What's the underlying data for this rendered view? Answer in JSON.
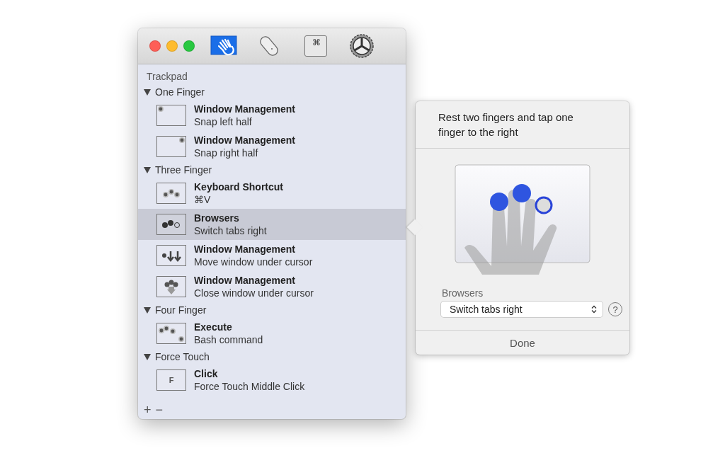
{
  "window": {
    "controls": [
      {
        "kind": "close"
      },
      {
        "kind": "minimize"
      },
      {
        "kind": "zoom"
      }
    ]
  },
  "toolbar": {
    "tabs": [
      {
        "kind": "trackpad",
        "selected": true
      },
      {
        "kind": "mouse",
        "selected": false
      },
      {
        "kind": "keyboard",
        "glyph": "⌘",
        "selected": false
      },
      {
        "kind": "settings",
        "selected": false
      }
    ]
  },
  "sidebar": {
    "title": "Trackpad",
    "sections": [
      {
        "label": "One Finger",
        "expanded": true,
        "items": [
          {
            "kind": "dot-left",
            "title": "Window Management",
            "subtitle": "Snap left half",
            "selected": false
          },
          {
            "kind": "dot-right",
            "title": "Window Management",
            "subtitle": "Snap right half",
            "selected": false
          }
        ]
      },
      {
        "label": "Three Finger",
        "expanded": true,
        "items": [
          {
            "kind": "three-dots",
            "title": "Keyboard Shortcut",
            "subtitle": "⌘V",
            "selected": false
          },
          {
            "kind": "tap-right",
            "title": "Browsers",
            "subtitle": "Switch tabs right",
            "selected": true
          },
          {
            "kind": "move-down",
            "title": "Window Management",
            "subtitle": "Move window under cursor",
            "selected": false
          },
          {
            "kind": "close-down",
            "title": "Window Management",
            "subtitle": "Close window under cursor",
            "selected": false
          }
        ]
      },
      {
        "label": "Four Finger",
        "expanded": true,
        "items": [
          {
            "kind": "four-dots",
            "title": "Execute",
            "subtitle": "Bash command",
            "selected": false
          }
        ]
      },
      {
        "label": "Force Touch",
        "expanded": true,
        "items": [
          {
            "kind": "letter",
            "glyph": "F",
            "title": "Click",
            "subtitle": "Force Touch Middle Click",
            "selected": false
          }
        ]
      }
    ],
    "footer": {
      "add": "+",
      "remove": "−"
    }
  },
  "popover": {
    "description": "Rest two fingers and tap one finger to the right",
    "category": "Browsers",
    "action": {
      "value": "Switch tabs right"
    },
    "help": "?",
    "done": "Done"
  }
}
